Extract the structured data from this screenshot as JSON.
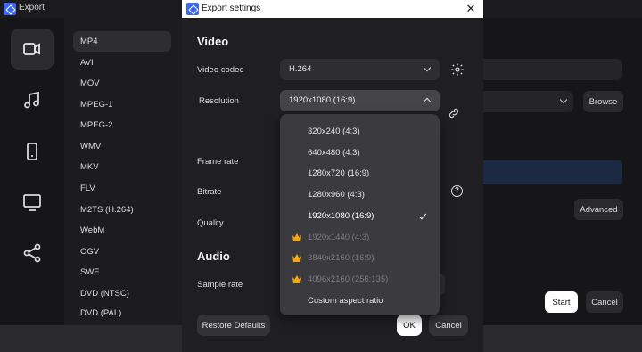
{
  "background": {
    "window_title": "Export",
    "nav": [
      "video-icon",
      "music-icon",
      "phone-icon",
      "monitor-icon",
      "share-icon"
    ],
    "formats": [
      "MP4",
      "AVI",
      "MOV",
      "MPEG-1",
      "MPEG-2",
      "WMV",
      "MKV",
      "FLV",
      "M2TS (H.264)",
      "WebM",
      "OGV",
      "SWF",
      "DVD (NTSC)",
      "DVD (PAL)"
    ],
    "selected_format": "MP4",
    "browse_label": "Browse",
    "advanced_label": "Advanced",
    "start_label": "Start",
    "cancel_label": "Cancel"
  },
  "dialog": {
    "title": "Export settings",
    "video_heading": "Video",
    "labels": {
      "video_codec": "Video codec",
      "resolution": "Resolution",
      "frame_rate": "Frame rate",
      "bitrate": "Bitrate",
      "quality": "Quality",
      "sample_rate": "Sample rate"
    },
    "video_codec_value": "H.264",
    "resolution_value": "1920x1080 (16:9)",
    "audio_heading": "Audio",
    "help_glyph": "?",
    "restore_label": "Restore Defaults",
    "ok_label": "OK",
    "cancel_label": "Cancel"
  },
  "resolution_menu": {
    "items": [
      {
        "label": "320x240 (4:3)",
        "premium": false,
        "selected": false
      },
      {
        "label": "640x480 (4:3)",
        "premium": false,
        "selected": false
      },
      {
        "label": "1280x720 (16:9)",
        "premium": false,
        "selected": false
      },
      {
        "label": "1280x960 (4:3)",
        "premium": false,
        "selected": false
      },
      {
        "label": "1920x1080 (16:9)",
        "premium": false,
        "selected": true
      },
      {
        "label": "1920x1440 (4:3)",
        "premium": true,
        "selected": false
      },
      {
        "label": "3840x2160 (16:9)",
        "premium": true,
        "selected": false
      },
      {
        "label": "4096x2160 (256:135)",
        "premium": true,
        "selected": false
      },
      {
        "label": "Custom aspect ratio",
        "premium": false,
        "selected": false
      }
    ]
  },
  "colors": {
    "accent": "#3d66f0",
    "crown": "#f0a816",
    "progress": "#1b2a42"
  }
}
